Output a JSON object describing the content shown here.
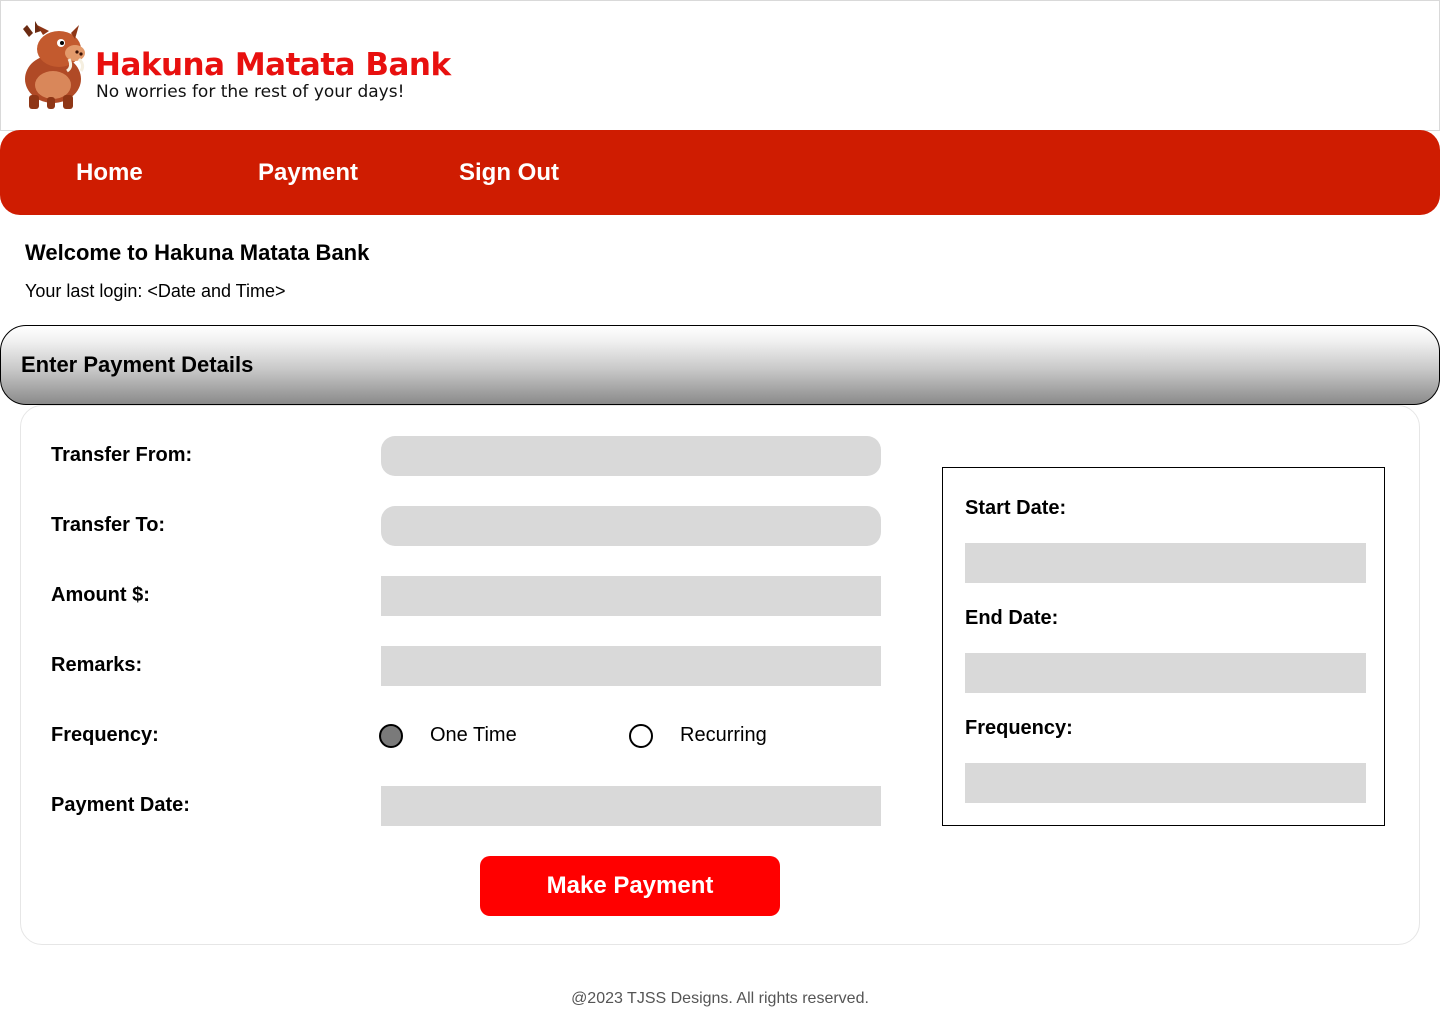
{
  "brand": {
    "name": "Hakuna Matata Bank",
    "tagline": "No worries for the rest of your days!"
  },
  "nav": {
    "items": [
      {
        "label": "Home"
      },
      {
        "label": "Payment"
      },
      {
        "label": "Sign Out"
      }
    ]
  },
  "welcome": {
    "title": "Welcome to Hakuna Matata Bank",
    "last_login": "Your last login: <Date and Time>"
  },
  "section": {
    "title": "Enter Payment Details"
  },
  "form": {
    "transfer_from_label": "Transfer From:",
    "transfer_to_label": "Transfer To:",
    "amount_label": "Amount $:",
    "remarks_label": "Remarks:",
    "frequency_label": "Frequency:",
    "frequency_options": [
      {
        "label": "One Time",
        "selected": true
      },
      {
        "label": "Recurring",
        "selected": false
      }
    ],
    "payment_date_label": "Payment Date:",
    "submit_label": "Make Payment"
  },
  "recurring": {
    "start_date_label": "Start Date:",
    "end_date_label": "End Date:",
    "frequency_label": "Frequency:"
  },
  "colors": {
    "brand_red": "#e8100f",
    "nav_red": "#cf1c01",
    "button_red": "#ff0000",
    "field_grey": "#d9d9d9"
  },
  "footer": {
    "text": "@2023 TJSS Designs. All rights reserved."
  }
}
